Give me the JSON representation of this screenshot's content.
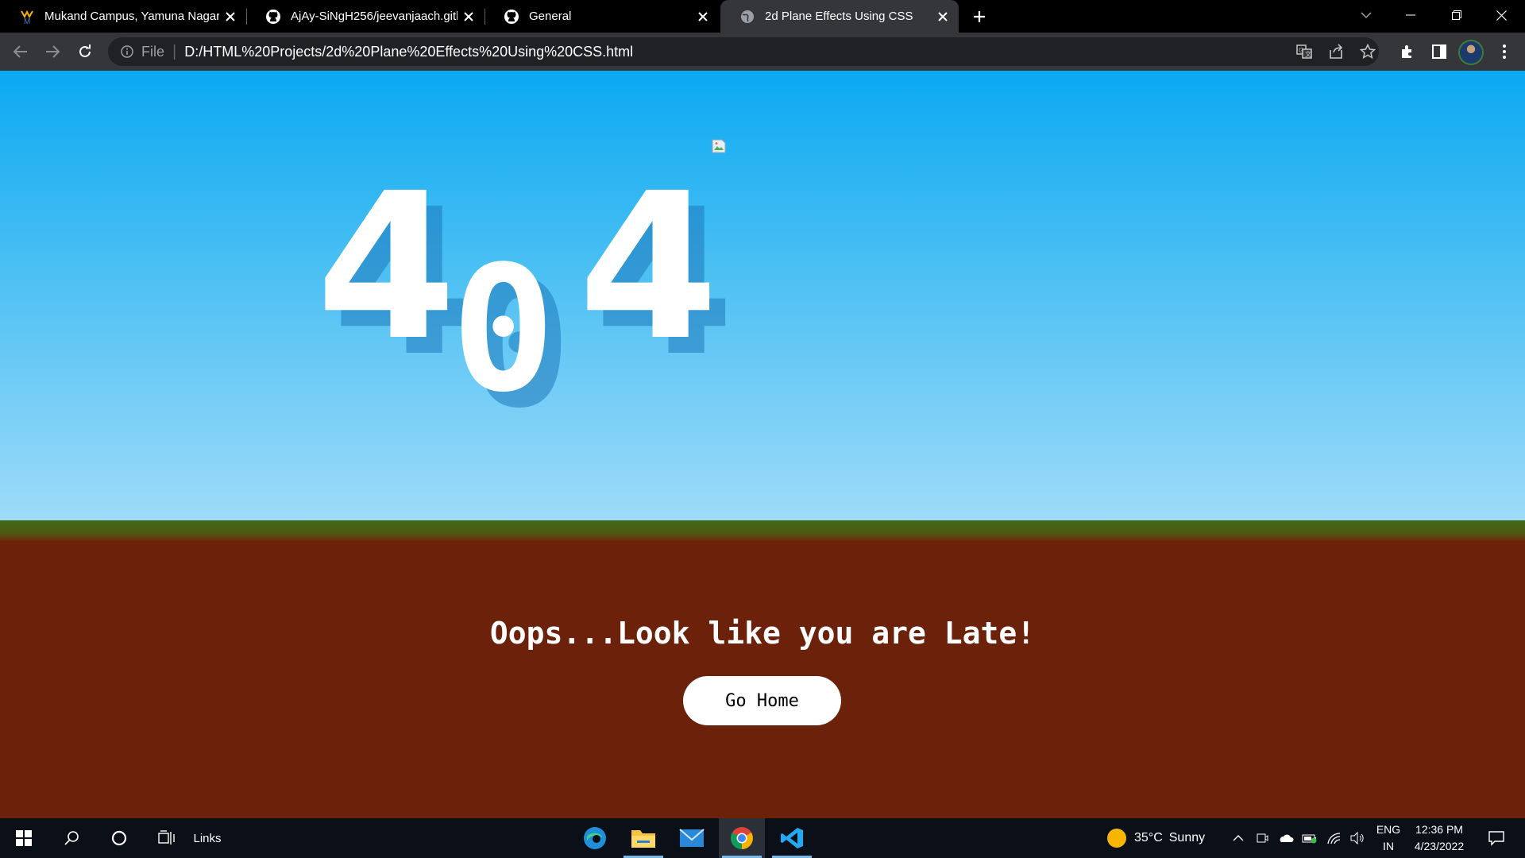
{
  "browser": {
    "tabs": [
      {
        "title": "Mukand Campus, Yamuna Nagar",
        "icon": "mukand-logo-icon",
        "active": false
      },
      {
        "title": "AjAy-SiNgH256/jeevanjaach.githu",
        "icon": "github-icon",
        "active": false
      },
      {
        "title": "General",
        "icon": "github-icon",
        "active": false
      },
      {
        "title": "2d Plane Effects Using CSS",
        "icon": "globe-icon",
        "active": true
      }
    ],
    "omnibox": {
      "scheme_label": "File",
      "url": "D:/HTML%20Projects/2d%20Plane%20Effects%20Using%20CSS.html"
    }
  },
  "page": {
    "digits": [
      "4",
      "0",
      "4"
    ],
    "message": "Oops...Look like you are Late!",
    "button_label": "Go Home",
    "colors": {
      "sky_top": "#0ba9f2",
      "sky_bottom": "#9edbf9",
      "grass": "#3d6b17",
      "ground": "#6c220a"
    }
  },
  "taskbar": {
    "links_label": "Links",
    "weather": {
      "temp": "35°C",
      "condition": "Sunny"
    },
    "language": {
      "line1": "ENG",
      "line2": "IN"
    },
    "clock": {
      "time": "12:36 PM",
      "date": "4/23/2022"
    },
    "apps": [
      "edge-icon",
      "file-explorer-icon",
      "mail-icon",
      "chrome-icon",
      "vscode-icon"
    ]
  }
}
